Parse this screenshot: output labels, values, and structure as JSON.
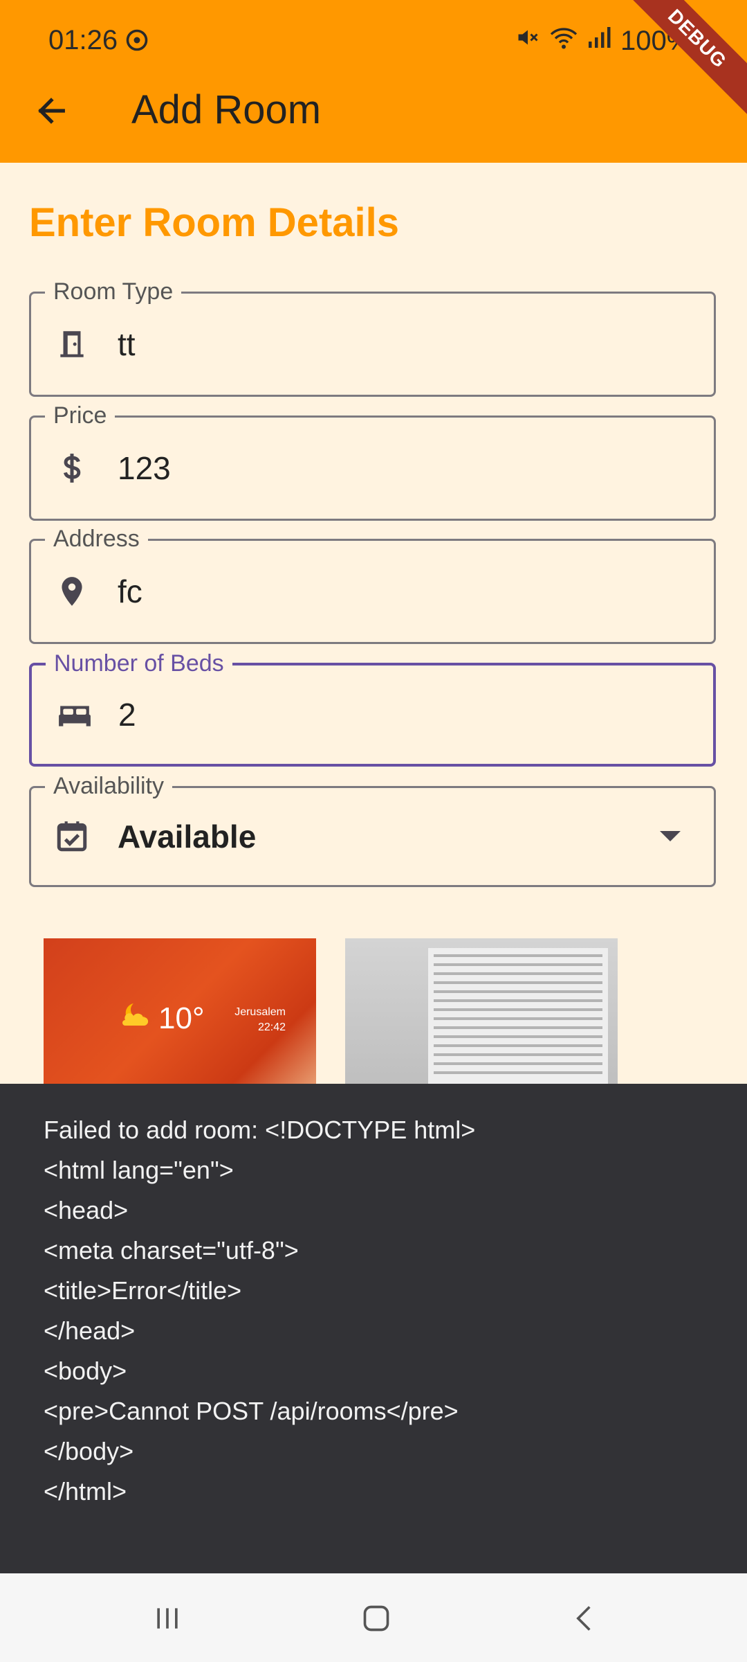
{
  "status_bar": {
    "time": "01:26",
    "battery": "100%"
  },
  "debug_banner": "DEBUG",
  "app_bar": {
    "title": "Add Room"
  },
  "form": {
    "heading": "Enter Room Details",
    "room_type": {
      "label": "Room Type",
      "value": "tt",
      "icon": "door-icon"
    },
    "price": {
      "label": "Price",
      "value": "123",
      "icon": "dollar-icon"
    },
    "address": {
      "label": "Address",
      "value": "fc",
      "icon": "location-pin-icon"
    },
    "beds": {
      "label": "Number of Beds",
      "value": "2",
      "icon": "bed-icon"
    },
    "availability": {
      "label": "Availability",
      "value": "Available",
      "icon": "calendar-check-icon"
    }
  },
  "images": [
    {
      "overlay_temp": "10°",
      "overlay_city": "Jerusalem",
      "overlay_time": "22:42"
    },
    {
      "description": "document"
    }
  ],
  "snackbar": {
    "lines": [
      "Failed to add room: <!DOCTYPE html>",
      "<html lang=\"en\">",
      "<head>",
      "<meta charset=\"utf-8\">",
      "<title>Error</title>",
      "</head>",
      "<body>",
      "<pre>Cannot POST /api/rooms</pre>",
      "</body>",
      "</html>"
    ]
  },
  "colors": {
    "primary": "#ff9800",
    "background": "#fff3e0",
    "focus": "#6750a4",
    "snackbar": "#323236"
  }
}
